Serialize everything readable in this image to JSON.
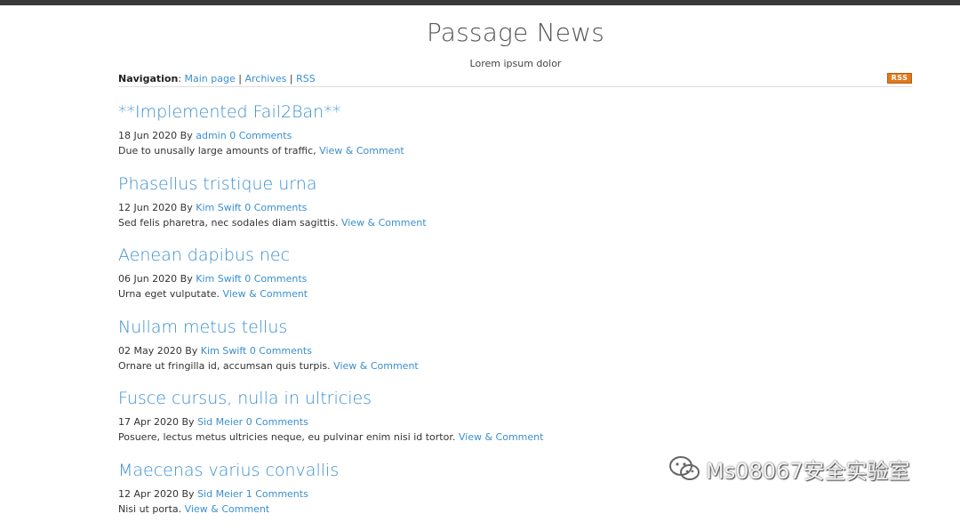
{
  "site": {
    "title": "Passage News",
    "subtitle": "Lorem ipsum dolor"
  },
  "nav": {
    "label": "Navigation",
    "colon": ":",
    "links": [
      "Main page",
      "Archives",
      "RSS"
    ],
    "separator": "|",
    "rss_badge": "RSS"
  },
  "posts": [
    {
      "title": "**Implemented Fail2Ban**",
      "date": "18 Jun 2020",
      "by": "By",
      "author": "admin",
      "comments": "0 Comments",
      "excerpt": "Due to unusally large amounts of traffic,",
      "link": "View & Comment"
    },
    {
      "title": "Phasellus tristique urna",
      "date": "12 Jun 2020",
      "by": "By",
      "author": "Kim Swift",
      "comments": "0 Comments",
      "excerpt": "Sed felis pharetra, nec sodales diam sagittis.",
      "link": "View & Comment"
    },
    {
      "title": "Aenean dapibus nec",
      "date": "06 Jun 2020",
      "by": "By",
      "author": "Kim Swift",
      "comments": "0 Comments",
      "excerpt": "Urna eget vulputate.",
      "link": "View & Comment"
    },
    {
      "title": "Nullam metus tellus",
      "date": "02 May 2020",
      "by": "By",
      "author": "Kim Swift",
      "comments": "0 Comments",
      "excerpt": "Ornare ut fringilla id, accumsan quis turpis.",
      "link": "View & Comment"
    },
    {
      "title": "Fusce cursus, nulla in ultricies",
      "date": "17 Apr 2020",
      "by": "By",
      "author": "Sid Meier",
      "comments": "0 Comments",
      "excerpt": "Posuere, lectus metus ultricies neque, eu pulvinar enim nisi id tortor.",
      "link": "View & Comment"
    },
    {
      "title": "Maecenas varius convallis",
      "date": "12 Apr 2020",
      "by": "By",
      "author": "Sid Meier",
      "comments": "1 Comments",
      "excerpt": "Nisi ut porta.",
      "link": "View & Comment"
    }
  ],
  "watermark": {
    "text": "Ms08067安全实验室",
    "icon": "wechat-icon"
  },
  "colors": {
    "link": "#3a8fcf",
    "rss_badge": "#e07a1c",
    "topbar": "#3a3a3a"
  }
}
